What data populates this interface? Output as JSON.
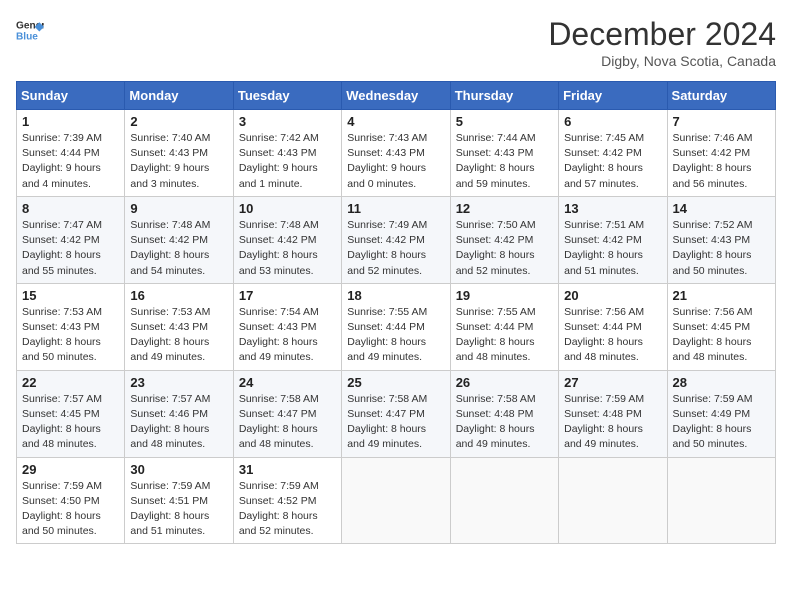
{
  "header": {
    "logo_line1": "General",
    "logo_line2": "Blue",
    "month": "December 2024",
    "location": "Digby, Nova Scotia, Canada"
  },
  "weekdays": [
    "Sunday",
    "Monday",
    "Tuesday",
    "Wednesday",
    "Thursday",
    "Friday",
    "Saturday"
  ],
  "weeks": [
    [
      {
        "day": "1",
        "sunrise": "Sunrise: 7:39 AM",
        "sunset": "Sunset: 4:44 PM",
        "daylight": "Daylight: 9 hours and 4 minutes."
      },
      {
        "day": "2",
        "sunrise": "Sunrise: 7:40 AM",
        "sunset": "Sunset: 4:43 PM",
        "daylight": "Daylight: 9 hours and 3 minutes."
      },
      {
        "day": "3",
        "sunrise": "Sunrise: 7:42 AM",
        "sunset": "Sunset: 4:43 PM",
        "daylight": "Daylight: 9 hours and 1 minute."
      },
      {
        "day": "4",
        "sunrise": "Sunrise: 7:43 AM",
        "sunset": "Sunset: 4:43 PM",
        "daylight": "Daylight: 9 hours and 0 minutes."
      },
      {
        "day": "5",
        "sunrise": "Sunrise: 7:44 AM",
        "sunset": "Sunset: 4:43 PM",
        "daylight": "Daylight: 8 hours and 59 minutes."
      },
      {
        "day": "6",
        "sunrise": "Sunrise: 7:45 AM",
        "sunset": "Sunset: 4:42 PM",
        "daylight": "Daylight: 8 hours and 57 minutes."
      },
      {
        "day": "7",
        "sunrise": "Sunrise: 7:46 AM",
        "sunset": "Sunset: 4:42 PM",
        "daylight": "Daylight: 8 hours and 56 minutes."
      }
    ],
    [
      {
        "day": "8",
        "sunrise": "Sunrise: 7:47 AM",
        "sunset": "Sunset: 4:42 PM",
        "daylight": "Daylight: 8 hours and 55 minutes."
      },
      {
        "day": "9",
        "sunrise": "Sunrise: 7:48 AM",
        "sunset": "Sunset: 4:42 PM",
        "daylight": "Daylight: 8 hours and 54 minutes."
      },
      {
        "day": "10",
        "sunrise": "Sunrise: 7:48 AM",
        "sunset": "Sunset: 4:42 PM",
        "daylight": "Daylight: 8 hours and 53 minutes."
      },
      {
        "day": "11",
        "sunrise": "Sunrise: 7:49 AM",
        "sunset": "Sunset: 4:42 PM",
        "daylight": "Daylight: 8 hours and 52 minutes."
      },
      {
        "day": "12",
        "sunrise": "Sunrise: 7:50 AM",
        "sunset": "Sunset: 4:42 PM",
        "daylight": "Daylight: 8 hours and 52 minutes."
      },
      {
        "day": "13",
        "sunrise": "Sunrise: 7:51 AM",
        "sunset": "Sunset: 4:42 PM",
        "daylight": "Daylight: 8 hours and 51 minutes."
      },
      {
        "day": "14",
        "sunrise": "Sunrise: 7:52 AM",
        "sunset": "Sunset: 4:43 PM",
        "daylight": "Daylight: 8 hours and 50 minutes."
      }
    ],
    [
      {
        "day": "15",
        "sunrise": "Sunrise: 7:53 AM",
        "sunset": "Sunset: 4:43 PM",
        "daylight": "Daylight: 8 hours and 50 minutes."
      },
      {
        "day": "16",
        "sunrise": "Sunrise: 7:53 AM",
        "sunset": "Sunset: 4:43 PM",
        "daylight": "Daylight: 8 hours and 49 minutes."
      },
      {
        "day": "17",
        "sunrise": "Sunrise: 7:54 AM",
        "sunset": "Sunset: 4:43 PM",
        "daylight": "Daylight: 8 hours and 49 minutes."
      },
      {
        "day": "18",
        "sunrise": "Sunrise: 7:55 AM",
        "sunset": "Sunset: 4:44 PM",
        "daylight": "Daylight: 8 hours and 49 minutes."
      },
      {
        "day": "19",
        "sunrise": "Sunrise: 7:55 AM",
        "sunset": "Sunset: 4:44 PM",
        "daylight": "Daylight: 8 hours and 48 minutes."
      },
      {
        "day": "20",
        "sunrise": "Sunrise: 7:56 AM",
        "sunset": "Sunset: 4:44 PM",
        "daylight": "Daylight: 8 hours and 48 minutes."
      },
      {
        "day": "21",
        "sunrise": "Sunrise: 7:56 AM",
        "sunset": "Sunset: 4:45 PM",
        "daylight": "Daylight: 8 hours and 48 minutes."
      }
    ],
    [
      {
        "day": "22",
        "sunrise": "Sunrise: 7:57 AM",
        "sunset": "Sunset: 4:45 PM",
        "daylight": "Daylight: 8 hours and 48 minutes."
      },
      {
        "day": "23",
        "sunrise": "Sunrise: 7:57 AM",
        "sunset": "Sunset: 4:46 PM",
        "daylight": "Daylight: 8 hours and 48 minutes."
      },
      {
        "day": "24",
        "sunrise": "Sunrise: 7:58 AM",
        "sunset": "Sunset: 4:47 PM",
        "daylight": "Daylight: 8 hours and 48 minutes."
      },
      {
        "day": "25",
        "sunrise": "Sunrise: 7:58 AM",
        "sunset": "Sunset: 4:47 PM",
        "daylight": "Daylight: 8 hours and 49 minutes."
      },
      {
        "day": "26",
        "sunrise": "Sunrise: 7:58 AM",
        "sunset": "Sunset: 4:48 PM",
        "daylight": "Daylight: 8 hours and 49 minutes."
      },
      {
        "day": "27",
        "sunrise": "Sunrise: 7:59 AM",
        "sunset": "Sunset: 4:48 PM",
        "daylight": "Daylight: 8 hours and 49 minutes."
      },
      {
        "day": "28",
        "sunrise": "Sunrise: 7:59 AM",
        "sunset": "Sunset: 4:49 PM",
        "daylight": "Daylight: 8 hours and 50 minutes."
      }
    ],
    [
      {
        "day": "29",
        "sunrise": "Sunrise: 7:59 AM",
        "sunset": "Sunset: 4:50 PM",
        "daylight": "Daylight: 8 hours and 50 minutes."
      },
      {
        "day": "30",
        "sunrise": "Sunrise: 7:59 AM",
        "sunset": "Sunset: 4:51 PM",
        "daylight": "Daylight: 8 hours and 51 minutes."
      },
      {
        "day": "31",
        "sunrise": "Sunrise: 7:59 AM",
        "sunset": "Sunset: 4:52 PM",
        "daylight": "Daylight: 8 hours and 52 minutes."
      },
      null,
      null,
      null,
      null
    ]
  ]
}
